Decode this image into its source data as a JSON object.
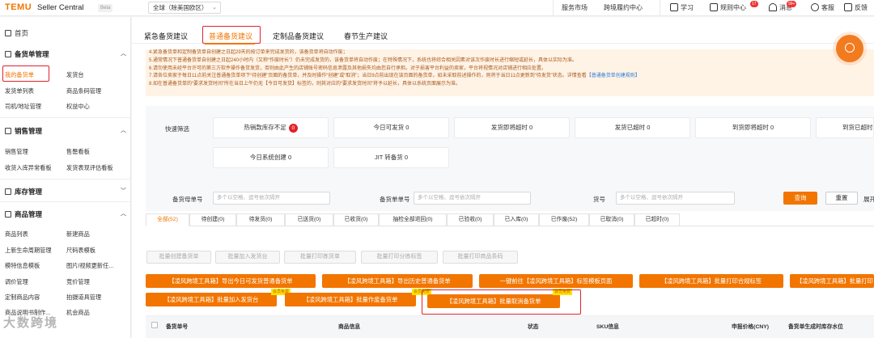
{
  "header": {
    "brand": "TEMU",
    "brand_sub": "Seller Central",
    "beta": "Beta",
    "region": "全球（除美国欧区）",
    "nav": [
      "服务市场",
      "跨境履约中心",
      "学习",
      "规则中心",
      "消息",
      "客服",
      "反馈"
    ],
    "badges": [
      "17",
      "99+"
    ]
  },
  "sidebar": {
    "home": "首页",
    "sections": [
      {
        "title": "备货单管理",
        "links": [
          "我的备货单",
          "发货台",
          "发货单列表",
          "商品条码管理",
          "司机/地址管理",
          "权益中心"
        ]
      },
      {
        "title": "销售管理",
        "links": [
          "销售管理",
          "售罄看板",
          "收货入库异常看板",
          "发货表现评估看板"
        ]
      },
      {
        "title": "库存管理",
        "links": []
      },
      {
        "title": "商品管理",
        "links": [
          "商品列表",
          "新建商品",
          "上新生命周期管理",
          "尺码表模板",
          "模特信息模板",
          "图片/视频更新任...",
          "调价管理",
          "竞价管理",
          "定制商品内容",
          "拍摄道具管理",
          "商品说明书制作...",
          "机会商品"
        ]
      }
    ]
  },
  "tabs": [
    "紧急备货建议",
    "普通备货建议",
    "定制品备货建议",
    "春节生产建议"
  ],
  "notice": [
    "4.紧急备货单和定制备货单自创建之日起29天的按订单来完成发货的，该备货单将自动作废；",
    "5.通常情况下普通备货单自创建之日起240小时内（又称“作废时长”）仍未完成发货的，该备货单将自动作废；在特殊情况下，系统也将综合相关因素对该次作废时长进行缩短或延长，具体以实际为准。",
    "6.请勿使用未经平台许可的第三方软件操作备货发货，否则由此产生的店铺账号密码信息泄露及其他损失均由您自行承担。对于损害平台利益的卖家，平台将视情况对店铺进行相应处置。",
    "7.请各位卖家于每日11点前关注普通备货单项下“待创建”页面的备货单，并及时操作“创建”或“取消”；当日9点前出现在该页面的备货单，如未采取前述操作的，则将于当日11点更新到“待发货”状态。详情查看",
    "【普通备货单创建规则】",
    "8.如在普通备货单的“要求发货时间”所在当日上午仍无【今日可发货】标签的，则其对应的“要求发货时间”将予以延长，具体以系统页面展示为准。"
  ],
  "filters": {
    "quick_label": "快速筛选",
    "quick": [
      "热销款库存不足",
      "今日可发货 0",
      "发货即将超时 0",
      "发货已超时 0",
      "到货即将超时 0",
      "到货已超时",
      "今日系统创建 0",
      "JIT 转备货 0"
    ],
    "quick_badge": "0",
    "order_no_label": "备货母单号",
    "order_no_ph": "多个以空格、逗号依次隔开",
    "sub_no_label": "备货单单号",
    "sub_no_ph": "多个以空格、逗号依次隔开",
    "sku_label": "货号",
    "sku_ph": "多个以空格、逗号依次隔开",
    "search": "查询",
    "reset": "重置",
    "expand": "展开"
  },
  "status_tabs": [
    "全部(52)",
    "待创建(0)",
    "待发货(0)",
    "已送货(0)",
    "已收货(0)",
    "抽检全部退回(0)",
    "已验收(0)",
    "已入库(0)",
    "已作废(52)",
    "已取消(0)",
    "已超时(0)"
  ],
  "grey_buttons": [
    "批量创建备货单",
    "批量加入发货台",
    "批量打印拣货单",
    "批量打印分拣标签",
    "批量打印商品条码"
  ],
  "plugin_buttons": [
    "【凌风跨境工具箱】导出今日可发货普通备货单",
    "【凌风跨境工具箱】导出历史普通备货单",
    "一键前往【凌风跨境工具箱】标签模板页面",
    "【凌风跨境工具箱】批量打印合规标签",
    "【凌风跨境工具箱】批量打印",
    "【凌风跨境工具箱】批量加入发货台",
    "【凌风跨境工具箱】批量作废备货单",
    "【凌风跨境工具箱】批量取消备货单"
  ],
  "tag_text": "会员免费",
  "table_headers": [
    "备货单号",
    "商品信息",
    "状态",
    "SKU信息",
    "申报价格(CNY)",
    "备货单生成时库存水位"
  ],
  "watermark": "大数跨境",
  "colors": {
    "accent": "#f27500",
    "highlight": "#e0222b",
    "notice_bg": "#fff3e6"
  }
}
